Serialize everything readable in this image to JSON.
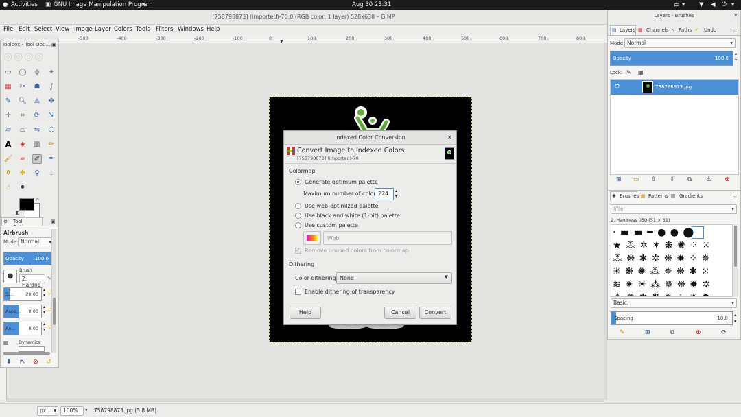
{
  "topbar": {
    "activities": "Activities",
    "app_name": "GNU Image Manipulation Program",
    "clock": "Aug 30  23:31",
    "lang": "中"
  },
  "window": {
    "title": "[758798873] (imported)-70.0 (RGB color, 1 layer) 528x638 – GIMP"
  },
  "menu": [
    "File",
    "Edit",
    "Select",
    "View",
    "Image",
    "Layer",
    "Colors",
    "Tools",
    "Filters",
    "Windows",
    "Help"
  ],
  "ruler": {
    "h_ticks": [
      "-500",
      "-400",
      "-300",
      "-200",
      "-100",
      "0",
      "100",
      "200",
      "300",
      "400",
      "500",
      "600",
      "700",
      "800"
    ]
  },
  "toolbox": {
    "title": "Toolbox - Tool Opti...",
    "tool_options_tab": "Tool Options",
    "tool_name": "Airbrush",
    "mode_label": "Mode:",
    "mode_value": "Normal",
    "opacity_label": "Opacity",
    "opacity_value": "100.0",
    "brush_label": "Brush",
    "brush_value": "2. Hardne",
    "size_label": "Si...",
    "size_value": "20.00",
    "aspect_label": "Aspe...",
    "aspect_value": "0.00",
    "angle_label": "An...",
    "angle_value": "0.00",
    "dynamics_label": "Dynamics"
  },
  "layers": {
    "title": "Layers - Brushes",
    "tabs": [
      "Layers",
      "Channels",
      "Paths",
      "Undo"
    ],
    "mode_label": "Mode:",
    "mode_value": "Normal",
    "opacity_label": "Opacity",
    "opacity_value": "100.0",
    "lock_label": "Lock:",
    "layer_name": "758798873.jpg"
  },
  "brushes": {
    "tabs": [
      "Brushes",
      "Patterns",
      "Gradients"
    ],
    "filter_placeholder": "filter",
    "brush_name": "2. Hardness 050 (51 × 51)",
    "preset": "Basic,",
    "spacing_label": "Spacing",
    "spacing_value": "10.0"
  },
  "dialog": {
    "title": "Indexed Color Conversion",
    "heading": "Convert Image to Indexed Colors",
    "subheading": "[758798873] (imported)-70",
    "colormap_label": "Colormap",
    "opt_generate": "Generate optimum palette",
    "max_colors_label": "Maximum number of colors:",
    "max_colors_value": "224",
    "opt_web": "Use web-optimized palette",
    "opt_bw": "Use black and white (1-bit) palette",
    "opt_custom": "Use custom palette",
    "custom_palette_value": "Web",
    "remove_unused": "Remove unused colors from colormap",
    "dithering_label": "Dithering",
    "color_dithering_label": "Color dithering:",
    "color_dithering_value": "None",
    "enable_dither_transparency": "Enable dithering of transparency",
    "help_button": "Help",
    "cancel_button": "Cancel",
    "convert_button": "Convert"
  },
  "status": {
    "unit": "px",
    "zoom": "100%",
    "file_info": "758798873.jpg (3.8 MB)"
  },
  "colors": {
    "accent": "#4a90d9",
    "logo_green": "#5fb233"
  }
}
